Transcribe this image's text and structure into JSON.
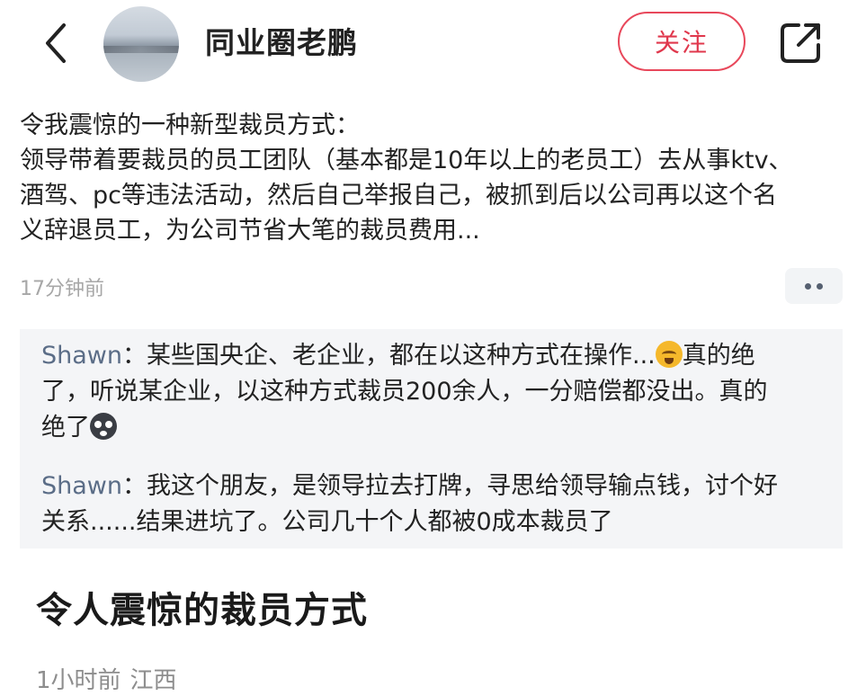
{
  "header": {
    "back_icon": "chevron-left-icon",
    "author_name": "同业圈老鹏",
    "follow_label": "关注",
    "share_icon": "share-external-icon",
    "accent_color": "#e0384d"
  },
  "post": {
    "lines": [
      "令我震惊的一种新型裁员方式：",
      "领导带着要裁员的员工团队（基本都是10年以上的老员工）去从事ktv、",
      "酒驾、pc等违法活动，然后自己举报自己，被抓到后以公司再以这个名",
      "义辞退员工，为公司节省大笔的裁员费用..."
    ],
    "timestamp": "17分钟前",
    "more_icon": "more-dots-icon"
  },
  "comments": [
    {
      "author": "Shawn",
      "line1_text": "：某些国央企、老企业，都在以这种方式在操作...",
      "line1_emoji": "crying-laughing-emoji",
      "line1_after": "真的绝",
      "line2": "了，听说某企业，以这种方式裁员200余人，一分赔偿都没出。真的",
      "line3_text": "绝了",
      "line3_emoji": "shocked-face-emoji"
    },
    {
      "author": "Shawn",
      "line1_text": "：我这个朋友，是领导拉去打牌，寻思给领导输点钱，讨个好",
      "line2": "关系......结果进坑了。公司几十个人都被0成本裁员了"
    }
  ],
  "article": {
    "title": "令人震惊的裁员方式",
    "time": "1小时前",
    "location": "江西"
  }
}
